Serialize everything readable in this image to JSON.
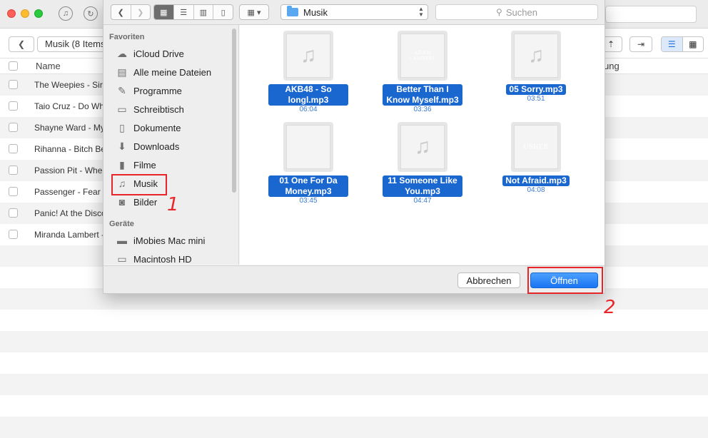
{
  "app": {
    "toolbar": {
      "breadcrumb": "Musik (8 Items)"
    },
    "table": {
      "header": {
        "name": "Name",
        "right_column": "ung"
      },
      "rows": [
        "The Weepies - Sir",
        "Taio Cruz - Do Wh",
        "Shayne Ward - My",
        "Rihanna - Bitch Be",
        "Passion Pit - Whe",
        "Passenger - Fear c",
        "Panic! At the Disco",
        "Miranda Lambert -"
      ]
    }
  },
  "dialog": {
    "location": "Musik",
    "search_placeholder": "Suchen",
    "sidebar": {
      "favorites_header": "Favoriten",
      "favorites": [
        {
          "label": "iCloud Drive",
          "icon": "cloud-icon"
        },
        {
          "label": "Alle meine Dateien",
          "icon": "all-files-icon"
        },
        {
          "label": "Programme",
          "icon": "applications-icon"
        },
        {
          "label": "Schreibtisch",
          "icon": "desktop-icon"
        },
        {
          "label": "Dokumente",
          "icon": "documents-icon"
        },
        {
          "label": "Downloads",
          "icon": "download-icon"
        },
        {
          "label": "Filme",
          "icon": "movies-icon"
        },
        {
          "label": "Musik",
          "icon": "music-icon"
        },
        {
          "label": "Bilder",
          "icon": "camera-icon"
        }
      ],
      "devices_header": "Geräte",
      "devices": [
        {
          "label": "iMobies Mac mini",
          "icon": "mac-mini-icon"
        },
        {
          "label": "Macintosh HD",
          "icon": "hard-disk-icon"
        }
      ]
    },
    "files": [
      {
        "name": "AKB48 - So longl.mp3",
        "duration": "06:04",
        "artwork": "placeholder"
      },
      {
        "name": "Better Than I Know Myself.mp3",
        "duration": "03:36",
        "artwork": "better",
        "art_text": "ADAM LAMBERT · BETTER THAN I KNOW MYSELF"
      },
      {
        "name": "05 Sorry.mp3",
        "duration": "03:51",
        "artwork": "placeholder"
      },
      {
        "name": "01 One For Da Money.mp3",
        "duration": "03:45",
        "artwork": "one"
      },
      {
        "name": "11 Someone Like You.mp3",
        "duration": "04:47",
        "artwork": "placeholder"
      },
      {
        "name": "Not Afraid.mp3",
        "duration": "04:08",
        "artwork": "usher",
        "art_text": "LEMME SEE · USHER"
      }
    ],
    "cancel_label": "Abbrechen",
    "open_label": "Öffnen"
  },
  "annotations": {
    "step1": "1",
    "step2": "2"
  },
  "colors": {
    "accent": "#1a67d0",
    "highlight": "#e8262a"
  }
}
